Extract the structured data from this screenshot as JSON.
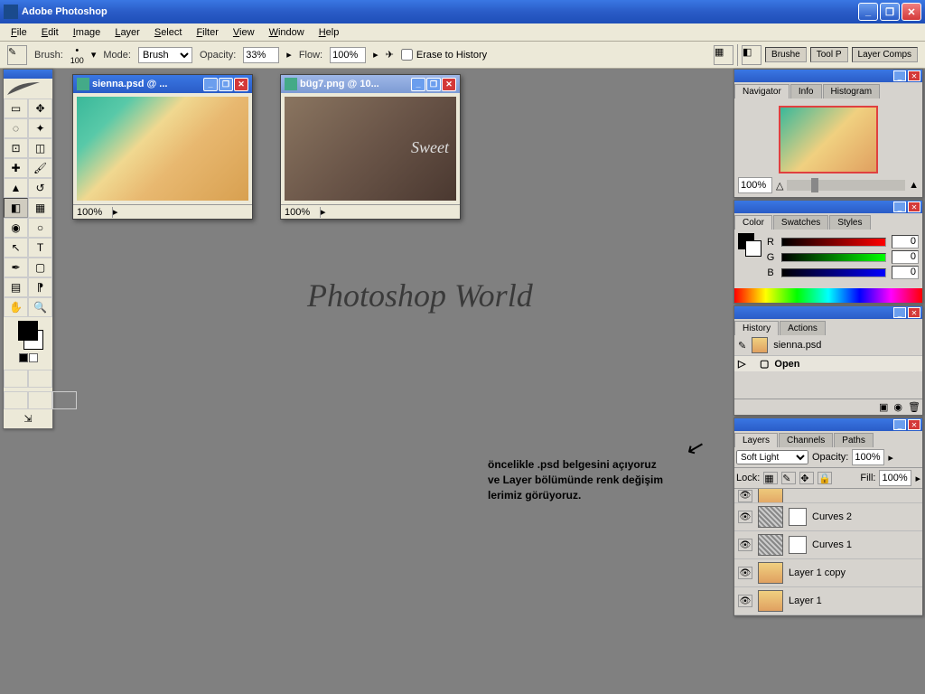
{
  "title": "Adobe Photoshop",
  "menu": [
    "File",
    "Edit",
    "Image",
    "Layer",
    "Select",
    "Filter",
    "View",
    "Window",
    "Help"
  ],
  "menu_keys": [
    "F",
    "E",
    "I",
    "L",
    "S",
    "F",
    "V",
    "W",
    "H"
  ],
  "options": {
    "brush_label": "Brush:",
    "brush_size": "100",
    "mode_label": "Mode:",
    "mode_value": "Brush",
    "opacity_label": "Opacity:",
    "opacity_value": "33%",
    "flow_label": "Flow:",
    "flow_value": "100%",
    "erase_label": "Erase to History"
  },
  "palette_well": [
    "Brushe",
    "Tool P",
    "Layer Comps"
  ],
  "documents": [
    {
      "title": "sienna.psd @ ...",
      "zoom": "100%",
      "active": true
    },
    {
      "title": "büg7.png @ 10...",
      "zoom": "100%",
      "active": false,
      "overlay": "Sweet"
    }
  ],
  "watermark": "Photoshop World",
  "annotation": " öncelikle .psd belgesini açıyoruz\nve Layer bölümünde renk değişim\nlerimiz görüyoruz.",
  "nav": {
    "tabs": [
      "Navigator",
      "Info",
      "Histogram"
    ],
    "zoom": "100%"
  },
  "color": {
    "tabs": [
      "Color",
      "Swatches",
      "Styles"
    ],
    "channels": [
      {
        "label": "R",
        "value": "0"
      },
      {
        "label": "G",
        "value": "0"
      },
      {
        "label": "B",
        "value": "0"
      }
    ]
  },
  "history": {
    "tabs": [
      "History",
      "Actions"
    ],
    "doc": "sienna.psd",
    "items": [
      "Open"
    ]
  },
  "layers": {
    "tabs": [
      "Layers",
      "Channels",
      "Paths"
    ],
    "blend": "Soft Light",
    "opacity_label": "Opacity:",
    "opacity": "100%",
    "lock_label": "Lock:",
    "fill_label": "Fill:",
    "fill": "100%",
    "items": [
      {
        "name": "Curves 2",
        "type": "adj"
      },
      {
        "name": "Curves 1",
        "type": "adj"
      },
      {
        "name": "Layer 1 copy",
        "type": "img"
      },
      {
        "name": "Layer 1",
        "type": "img"
      }
    ]
  }
}
